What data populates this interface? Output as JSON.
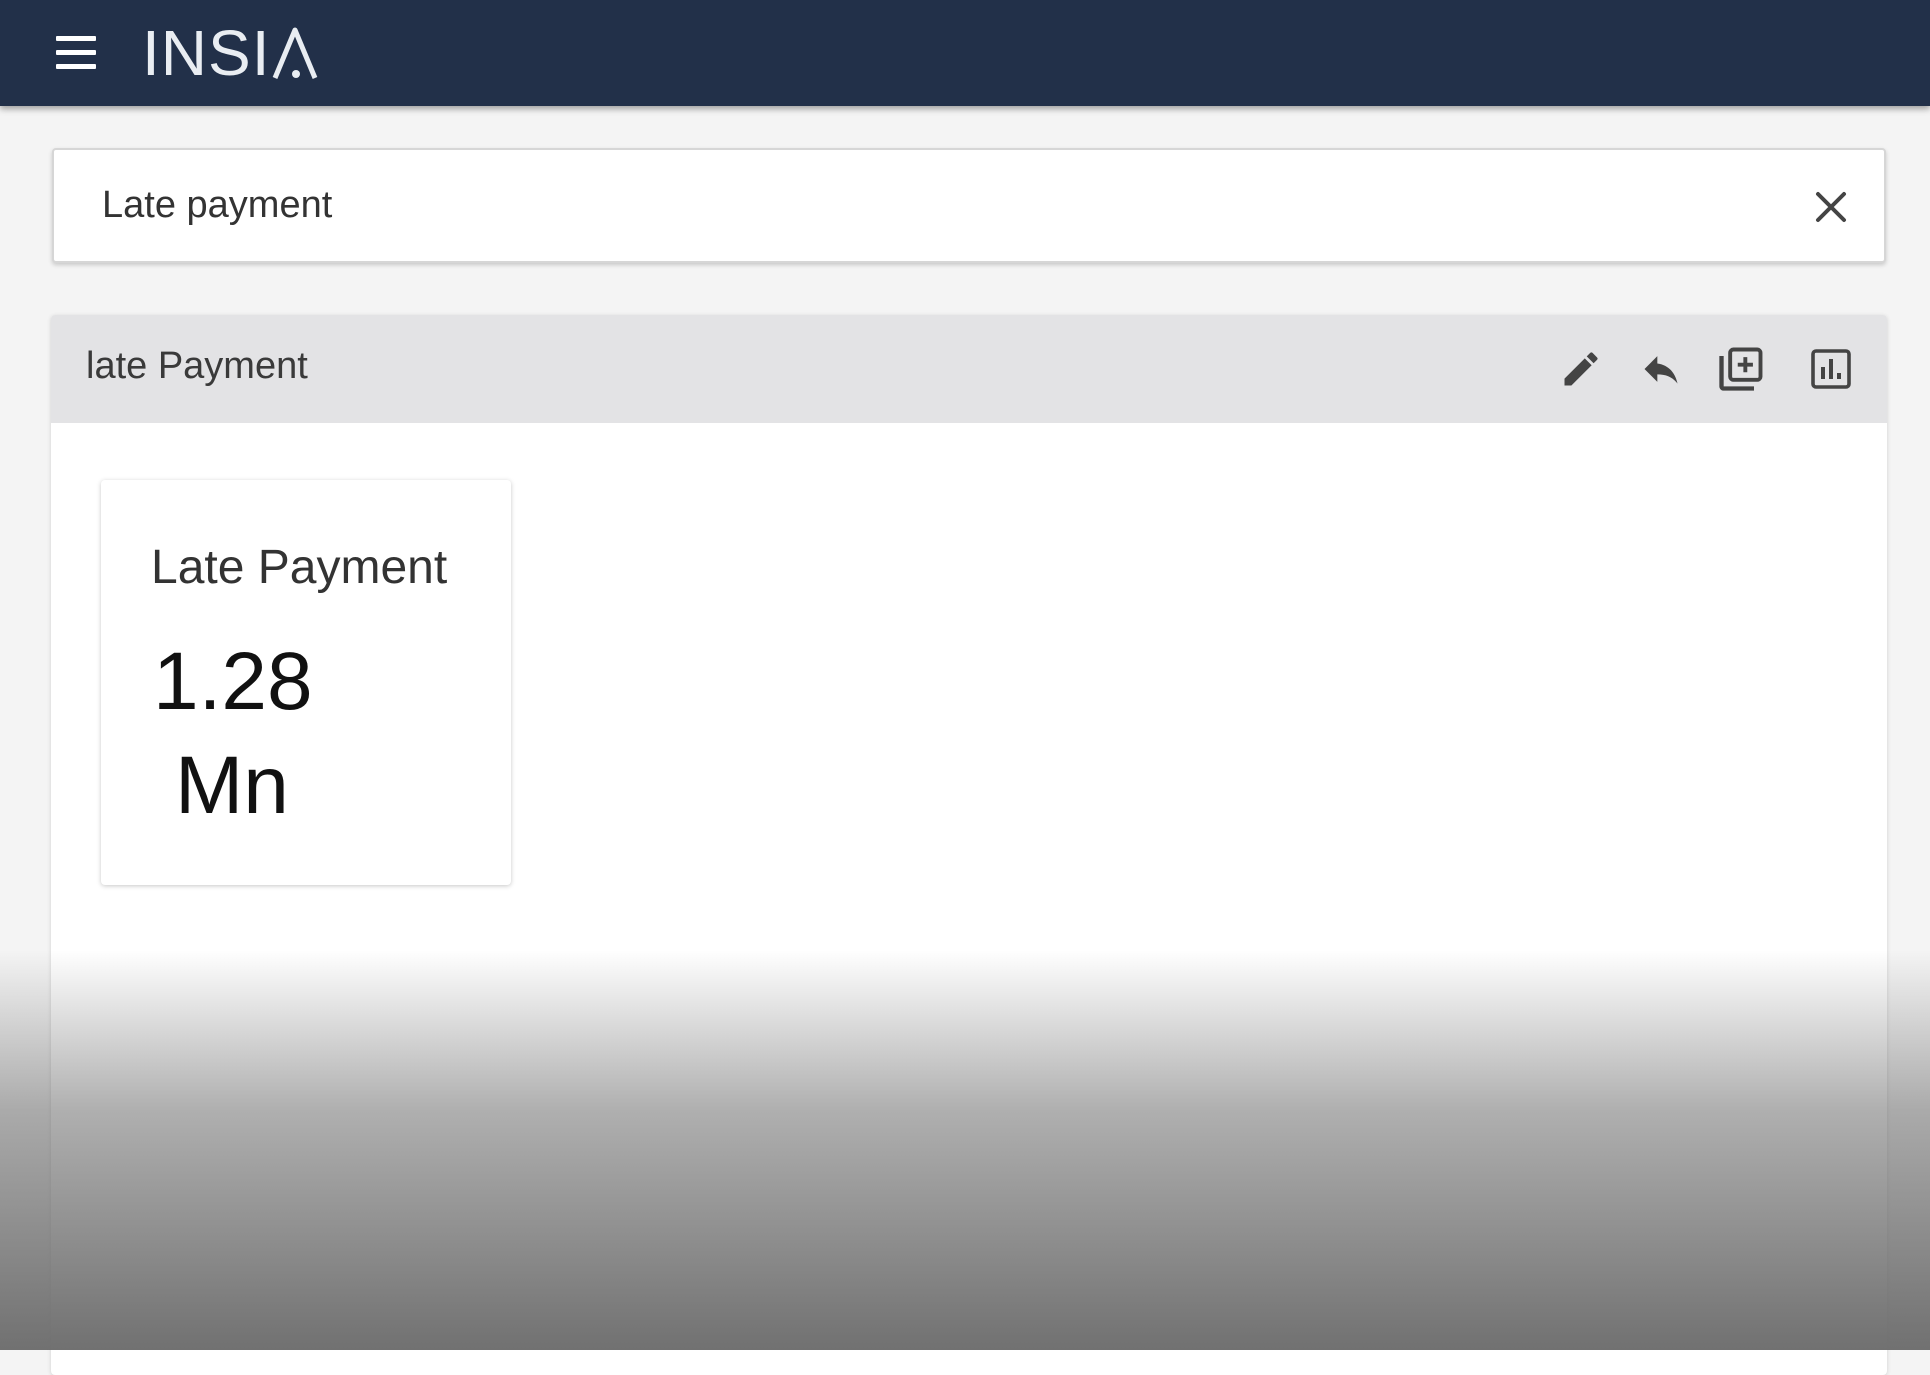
{
  "header": {
    "brand": "INSI",
    "brand_icon": "insia-a-glyph-icon",
    "background": "#223049"
  },
  "search": {
    "value": "Late payment",
    "clear_icon": "close-icon"
  },
  "panel": {
    "title": "late Payment",
    "tools": [
      {
        "name": "edit",
        "icon": "pencil-icon"
      },
      {
        "name": "reply",
        "icon": "reply-arrow-icon"
      },
      {
        "name": "add-to-dashboard",
        "icon": "library-add-icon"
      },
      {
        "name": "chart-view",
        "icon": "bar-chart-icon"
      }
    ]
  },
  "kpi": {
    "label": "Late Payment",
    "value": "1.28",
    "unit": "Mn"
  }
}
